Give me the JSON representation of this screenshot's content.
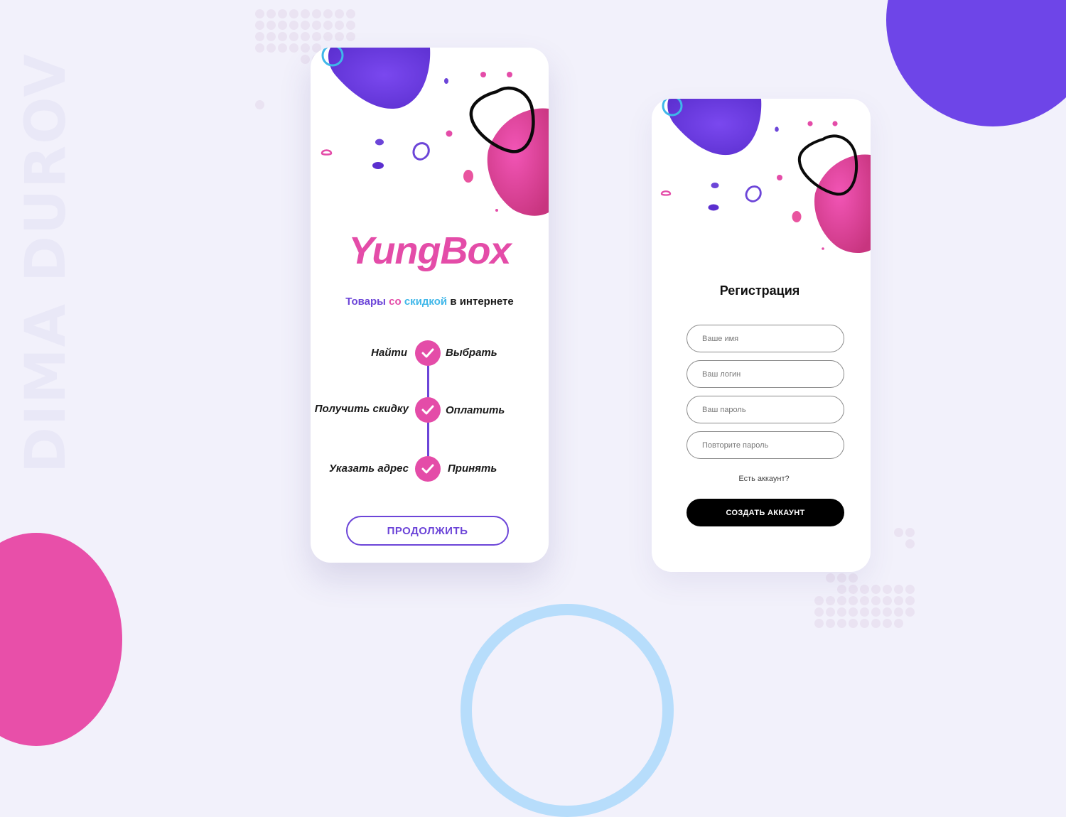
{
  "watermark": "DIMA DUROV",
  "colors": {
    "background": "#f2f1fb",
    "brand_pink": "#e44ca8",
    "brand_purple": "#6c45d8",
    "accent_blue": "#3fb7e9",
    "ring_blue": "#b7ddfb"
  },
  "welcome_screen": {
    "logo": "YungBox",
    "tagline": {
      "part1": "Товары",
      "part2": "со",
      "part3": "скидкой",
      "part4": "в интернете"
    },
    "steps": {
      "left": [
        "Найти",
        "Получить скидку",
        "Указать адрес"
      ],
      "right": [
        "Выбрать",
        "Оплатить",
        "Принять"
      ],
      "icon": "check-icon"
    },
    "continue_button": "ПРОДОЛЖИТЬ"
  },
  "register_screen": {
    "title": "Регистрация",
    "fields": {
      "name_placeholder": "Ваше имя",
      "login_placeholder": "Ваш логин",
      "password_placeholder": "Ваш пароль",
      "repeat_placeholder": "Повторите пароль"
    },
    "have_account_link": "Есть аккаунт?",
    "create_button": "СОЗДАТЬ АККАУНТ"
  }
}
